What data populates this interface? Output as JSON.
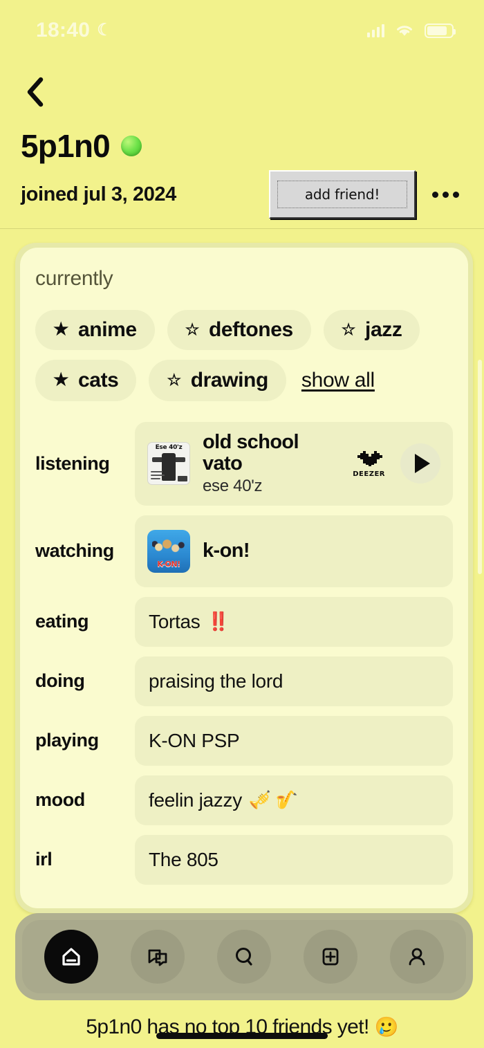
{
  "status_bar": {
    "time": "18:40",
    "moon_icon": "crescent-moon-icon",
    "signal_icon": "cellular-signal-icon",
    "wifi_icon": "wifi-icon",
    "battery_icon": "battery-icon"
  },
  "header": {
    "back_icon": "chevron-left-icon",
    "username": "5p1n0",
    "online_status": "online",
    "joined": "joined jul 3, 2024",
    "add_friend_label": "add friend!",
    "more_icon": "more-horizontal-icon"
  },
  "currently_card": {
    "title": "currently",
    "tags": [
      {
        "label": "anime",
        "star": "★",
        "starred": true
      },
      {
        "label": "deftones",
        "star": "☆",
        "starred": false
      },
      {
        "label": "jazz",
        "star": "☆",
        "starred": false
      },
      {
        "label": "cats",
        "star": "★",
        "starred": true
      },
      {
        "label": "drawing",
        "star": "☆",
        "starred": false
      }
    ],
    "show_all_label": "show all",
    "listening": {
      "label": "listening",
      "track_title": "old school vato",
      "track_artist": "ese 40'z",
      "album_art_title": "Ese 40'z",
      "service": "DEEZER",
      "service_icon": "deezer-heart-icon",
      "play_icon": "play-icon"
    },
    "watching": {
      "label": "watching",
      "value": "k-on!",
      "thumb_logo": "K-ON!"
    },
    "rows": [
      {
        "label": "eating",
        "value": "Tortas",
        "suffix": "‼️"
      },
      {
        "label": "doing",
        "value": "praising the lord",
        "suffix": ""
      },
      {
        "label": "playing",
        "value": "K-ON PSP",
        "suffix": ""
      },
      {
        "label": "mood",
        "value": "feelin jazzy",
        "suffix": "🎺 🎷"
      },
      {
        "label": "irl",
        "value": "The 805",
        "suffix": ""
      }
    ]
  },
  "bottom_nav": {
    "items": [
      {
        "name": "home",
        "icon": "home-icon",
        "active": true
      },
      {
        "name": "chat",
        "icon": "chat-icon",
        "active": false
      },
      {
        "name": "search",
        "icon": "search-icon",
        "active": false
      },
      {
        "name": "create",
        "icon": "plus-box-icon",
        "active": false
      },
      {
        "name": "profile",
        "icon": "person-icon",
        "active": false
      }
    ]
  },
  "footer": {
    "note": "5p1n0 has no top 10 friends yet!",
    "emoji": "🥲"
  },
  "colors": {
    "background": "#f2f28c",
    "card": "#fafbcf",
    "card_frame": "#e6e9a9",
    "pill": "#eef0c4",
    "nav": "#a9a98c",
    "online": "#6ee24a",
    "accent_red": "#e3322a"
  }
}
